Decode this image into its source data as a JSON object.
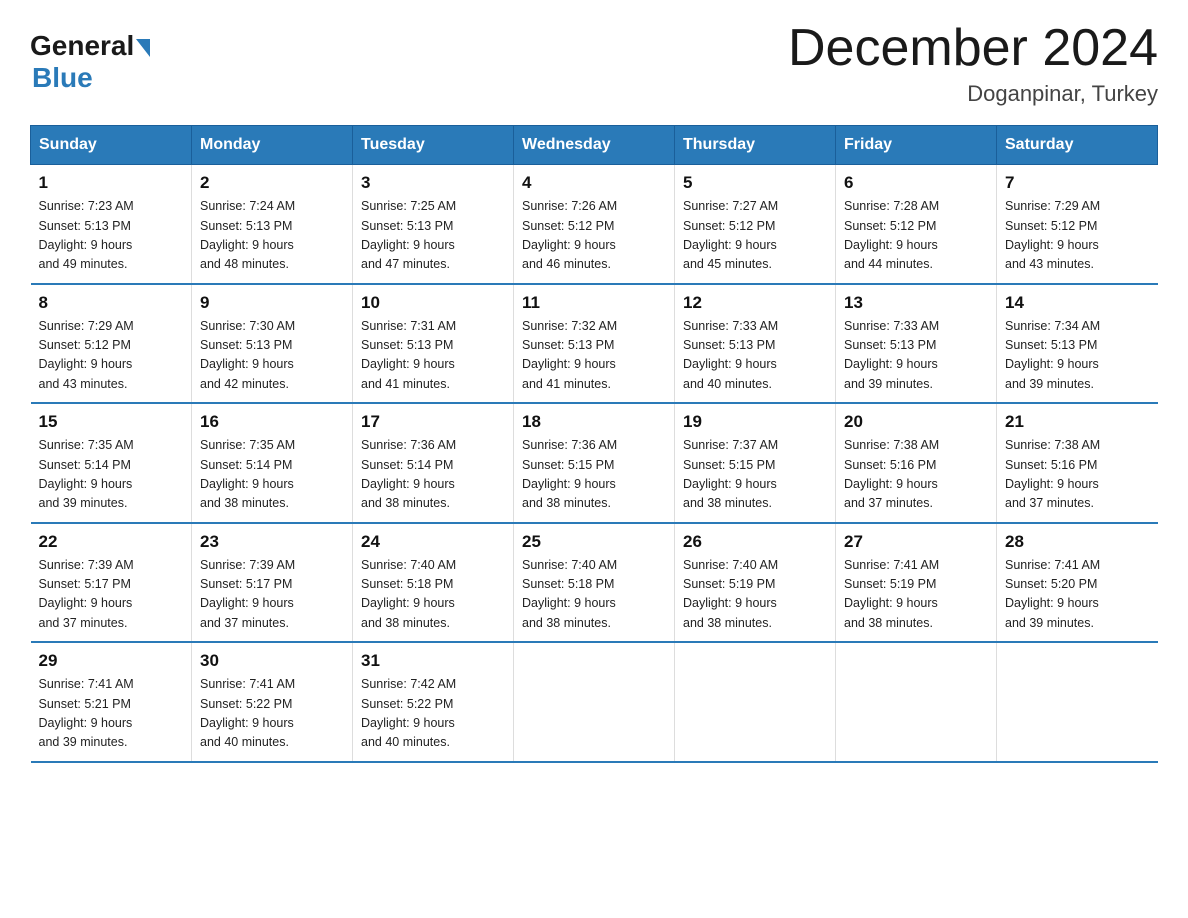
{
  "header": {
    "logo_general": "General",
    "logo_blue": "Blue",
    "title": "December 2024",
    "location": "Doganpinar, Turkey"
  },
  "columns": [
    "Sunday",
    "Monday",
    "Tuesday",
    "Wednesday",
    "Thursday",
    "Friday",
    "Saturday"
  ],
  "weeks": [
    [
      {
        "day": "1",
        "sunrise": "7:23 AM",
        "sunset": "5:13 PM",
        "daylight": "9 hours and 49 minutes."
      },
      {
        "day": "2",
        "sunrise": "7:24 AM",
        "sunset": "5:13 PM",
        "daylight": "9 hours and 48 minutes."
      },
      {
        "day": "3",
        "sunrise": "7:25 AM",
        "sunset": "5:13 PM",
        "daylight": "9 hours and 47 minutes."
      },
      {
        "day": "4",
        "sunrise": "7:26 AM",
        "sunset": "5:12 PM",
        "daylight": "9 hours and 46 minutes."
      },
      {
        "day": "5",
        "sunrise": "7:27 AM",
        "sunset": "5:12 PM",
        "daylight": "9 hours and 45 minutes."
      },
      {
        "day": "6",
        "sunrise": "7:28 AM",
        "sunset": "5:12 PM",
        "daylight": "9 hours and 44 minutes."
      },
      {
        "day": "7",
        "sunrise": "7:29 AM",
        "sunset": "5:12 PM",
        "daylight": "9 hours and 43 minutes."
      }
    ],
    [
      {
        "day": "8",
        "sunrise": "7:29 AM",
        "sunset": "5:12 PM",
        "daylight": "9 hours and 43 minutes."
      },
      {
        "day": "9",
        "sunrise": "7:30 AM",
        "sunset": "5:13 PM",
        "daylight": "9 hours and 42 minutes."
      },
      {
        "day": "10",
        "sunrise": "7:31 AM",
        "sunset": "5:13 PM",
        "daylight": "9 hours and 41 minutes."
      },
      {
        "day": "11",
        "sunrise": "7:32 AM",
        "sunset": "5:13 PM",
        "daylight": "9 hours and 41 minutes."
      },
      {
        "day": "12",
        "sunrise": "7:33 AM",
        "sunset": "5:13 PM",
        "daylight": "9 hours and 40 minutes."
      },
      {
        "day": "13",
        "sunrise": "7:33 AM",
        "sunset": "5:13 PM",
        "daylight": "9 hours and 39 minutes."
      },
      {
        "day": "14",
        "sunrise": "7:34 AM",
        "sunset": "5:13 PM",
        "daylight": "9 hours and 39 minutes."
      }
    ],
    [
      {
        "day": "15",
        "sunrise": "7:35 AM",
        "sunset": "5:14 PM",
        "daylight": "9 hours and 39 minutes."
      },
      {
        "day": "16",
        "sunrise": "7:35 AM",
        "sunset": "5:14 PM",
        "daylight": "9 hours and 38 minutes."
      },
      {
        "day": "17",
        "sunrise": "7:36 AM",
        "sunset": "5:14 PM",
        "daylight": "9 hours and 38 minutes."
      },
      {
        "day": "18",
        "sunrise": "7:36 AM",
        "sunset": "5:15 PM",
        "daylight": "9 hours and 38 minutes."
      },
      {
        "day": "19",
        "sunrise": "7:37 AM",
        "sunset": "5:15 PM",
        "daylight": "9 hours and 38 minutes."
      },
      {
        "day": "20",
        "sunrise": "7:38 AM",
        "sunset": "5:16 PM",
        "daylight": "9 hours and 37 minutes."
      },
      {
        "day": "21",
        "sunrise": "7:38 AM",
        "sunset": "5:16 PM",
        "daylight": "9 hours and 37 minutes."
      }
    ],
    [
      {
        "day": "22",
        "sunrise": "7:39 AM",
        "sunset": "5:17 PM",
        "daylight": "9 hours and 37 minutes."
      },
      {
        "day": "23",
        "sunrise": "7:39 AM",
        "sunset": "5:17 PM",
        "daylight": "9 hours and 37 minutes."
      },
      {
        "day": "24",
        "sunrise": "7:40 AM",
        "sunset": "5:18 PM",
        "daylight": "9 hours and 38 minutes."
      },
      {
        "day": "25",
        "sunrise": "7:40 AM",
        "sunset": "5:18 PM",
        "daylight": "9 hours and 38 minutes."
      },
      {
        "day": "26",
        "sunrise": "7:40 AM",
        "sunset": "5:19 PM",
        "daylight": "9 hours and 38 minutes."
      },
      {
        "day": "27",
        "sunrise": "7:41 AM",
        "sunset": "5:19 PM",
        "daylight": "9 hours and 38 minutes."
      },
      {
        "day": "28",
        "sunrise": "7:41 AM",
        "sunset": "5:20 PM",
        "daylight": "9 hours and 39 minutes."
      }
    ],
    [
      {
        "day": "29",
        "sunrise": "7:41 AM",
        "sunset": "5:21 PM",
        "daylight": "9 hours and 39 minutes."
      },
      {
        "day": "30",
        "sunrise": "7:41 AM",
        "sunset": "5:22 PM",
        "daylight": "9 hours and 40 minutes."
      },
      {
        "day": "31",
        "sunrise": "7:42 AM",
        "sunset": "5:22 PM",
        "daylight": "9 hours and 40 minutes."
      },
      null,
      null,
      null,
      null
    ]
  ],
  "labels": {
    "sunrise": "Sunrise:",
    "sunset": "Sunset:",
    "daylight": "Daylight: 9 hours"
  }
}
